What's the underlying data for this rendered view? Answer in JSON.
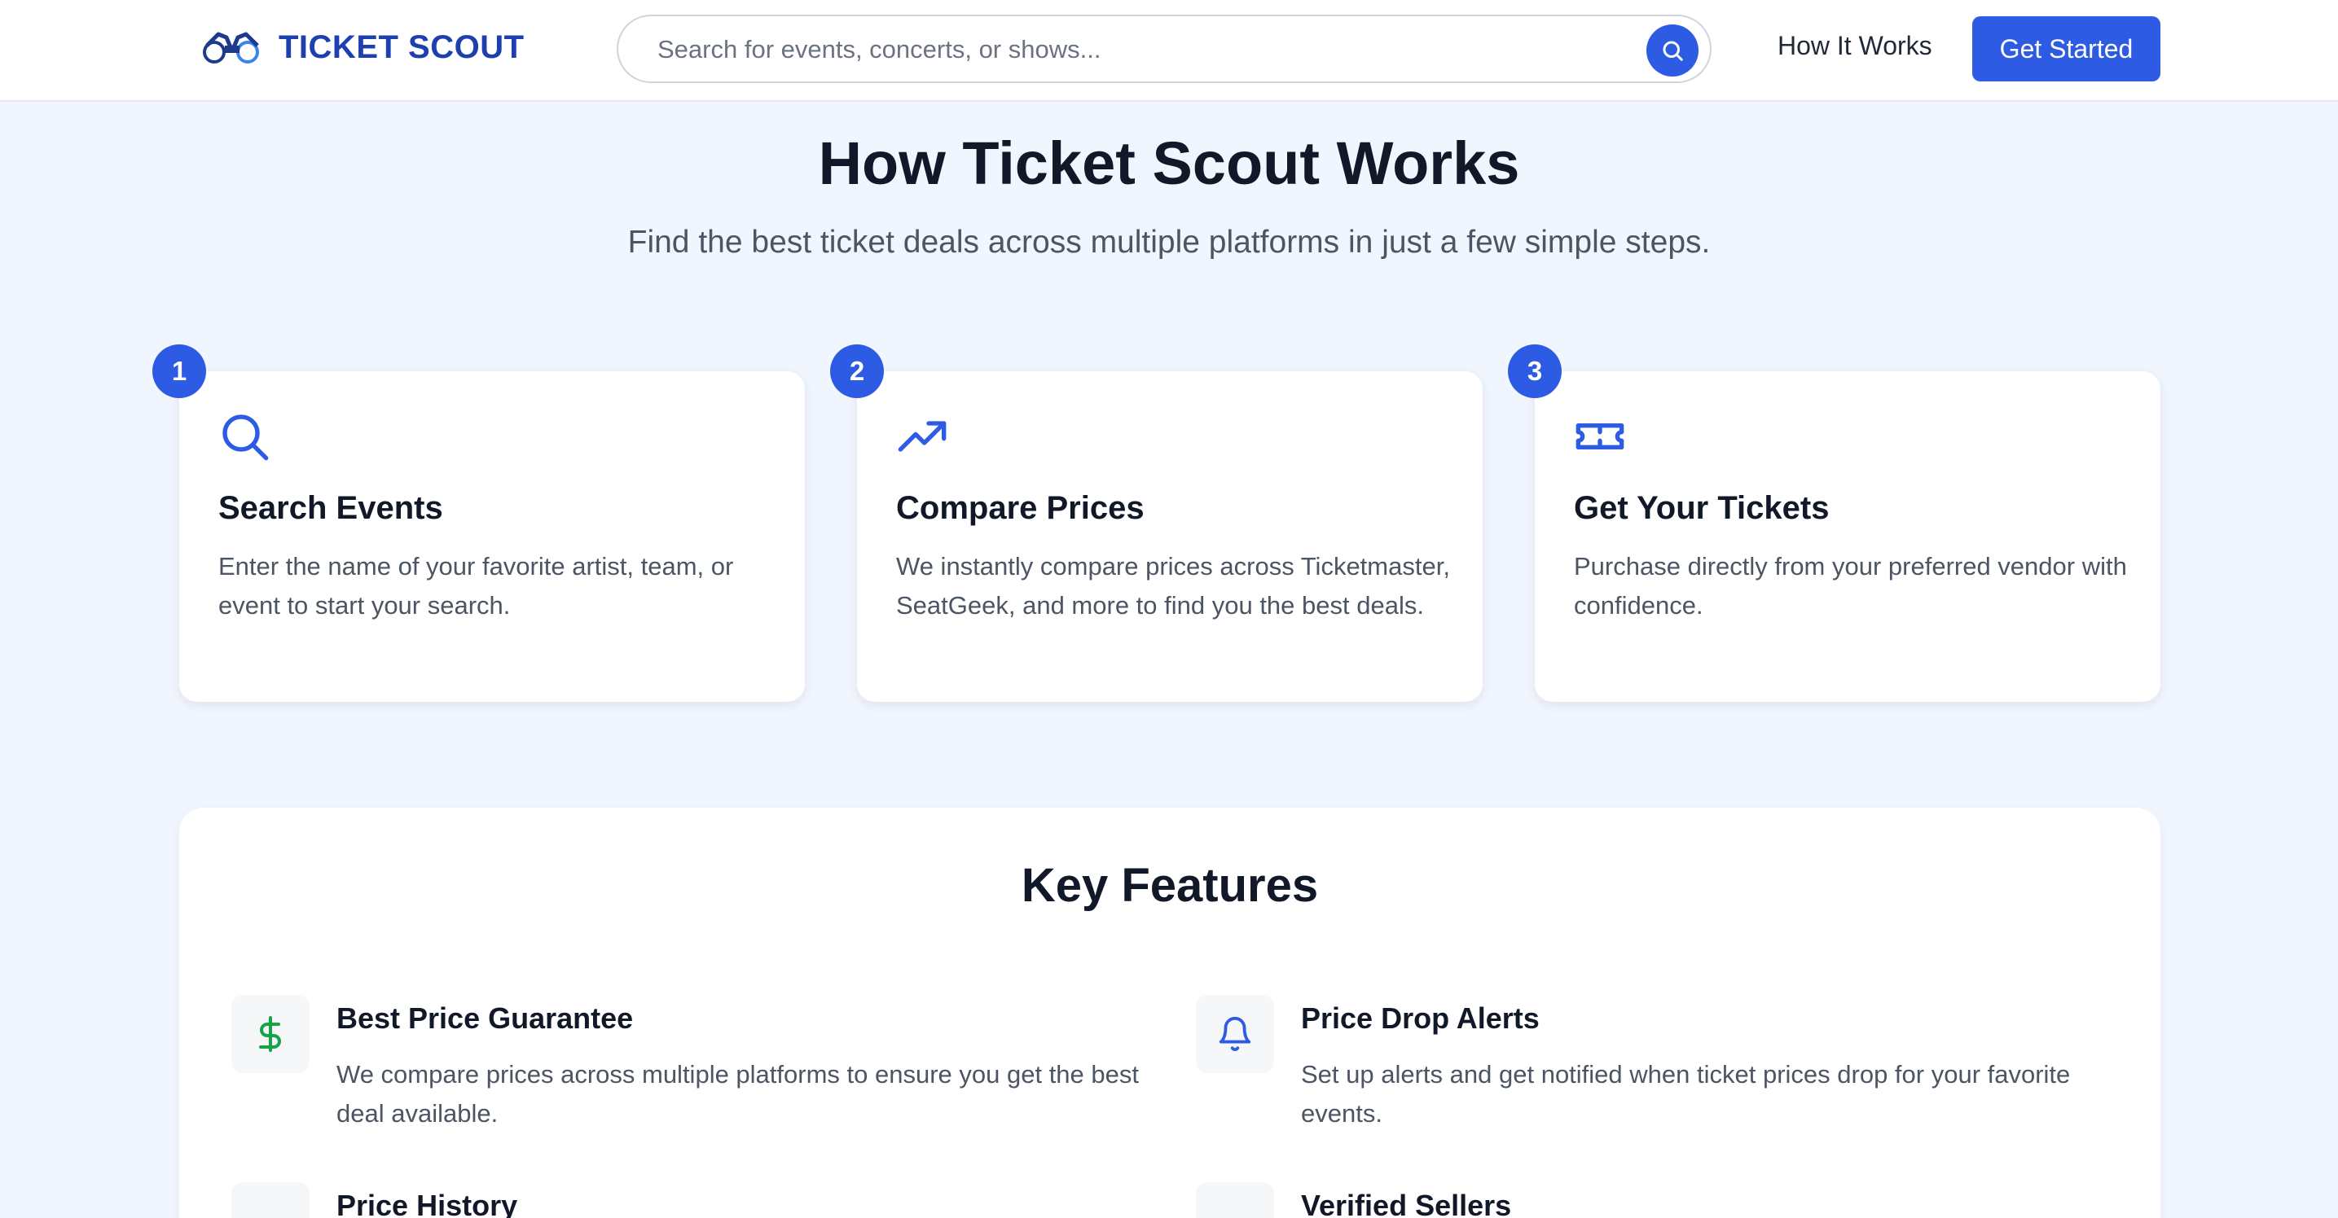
{
  "header": {
    "logo_text": "TICKET SCOUT",
    "search_placeholder": "Search for events, concerts, or shows...",
    "nav_link": "How It Works",
    "cta": "Get Started"
  },
  "hero": {
    "title": "How Ticket Scout Works",
    "subtitle": "Find the best ticket deals across multiple platforms in just a few simple steps."
  },
  "steps": [
    {
      "number": "1",
      "icon": "search-icon",
      "title": "Search Events",
      "description": "Enter the name of your favorite artist, team, or event to start your search."
    },
    {
      "number": "2",
      "icon": "trending-up-icon",
      "title": "Compare Prices",
      "description": "We instantly compare prices across Ticketmaster, SeatGeek, and more to find you the best deals."
    },
    {
      "number": "3",
      "icon": "ticket-icon",
      "title": "Get Your Tickets",
      "description": "Purchase directly from your preferred vendor with confidence."
    }
  ],
  "features": {
    "title": "Key Features",
    "items": [
      {
        "icon": "dollar-icon",
        "color": "#16a34a",
        "title": "Best Price Guarantee",
        "description": "We compare prices across multiple platforms to ensure you get the best deal available."
      },
      {
        "icon": "bell-icon",
        "color": "#2d5be3",
        "title": "Price Drop Alerts",
        "description": "Set up alerts and get notified when ticket prices drop for your favorite events."
      },
      {
        "icon": "price-history-icon",
        "color": "#9333ea",
        "title": "Price History",
        "description": ""
      },
      {
        "icon": "verified-sellers-icon",
        "color": "#2d5be3",
        "title": "Verified Sellers",
        "description": ""
      }
    ]
  },
  "colors": {
    "accent": "#2d5be3",
    "brand": "#1e40af",
    "background": "#f1f5fd"
  }
}
